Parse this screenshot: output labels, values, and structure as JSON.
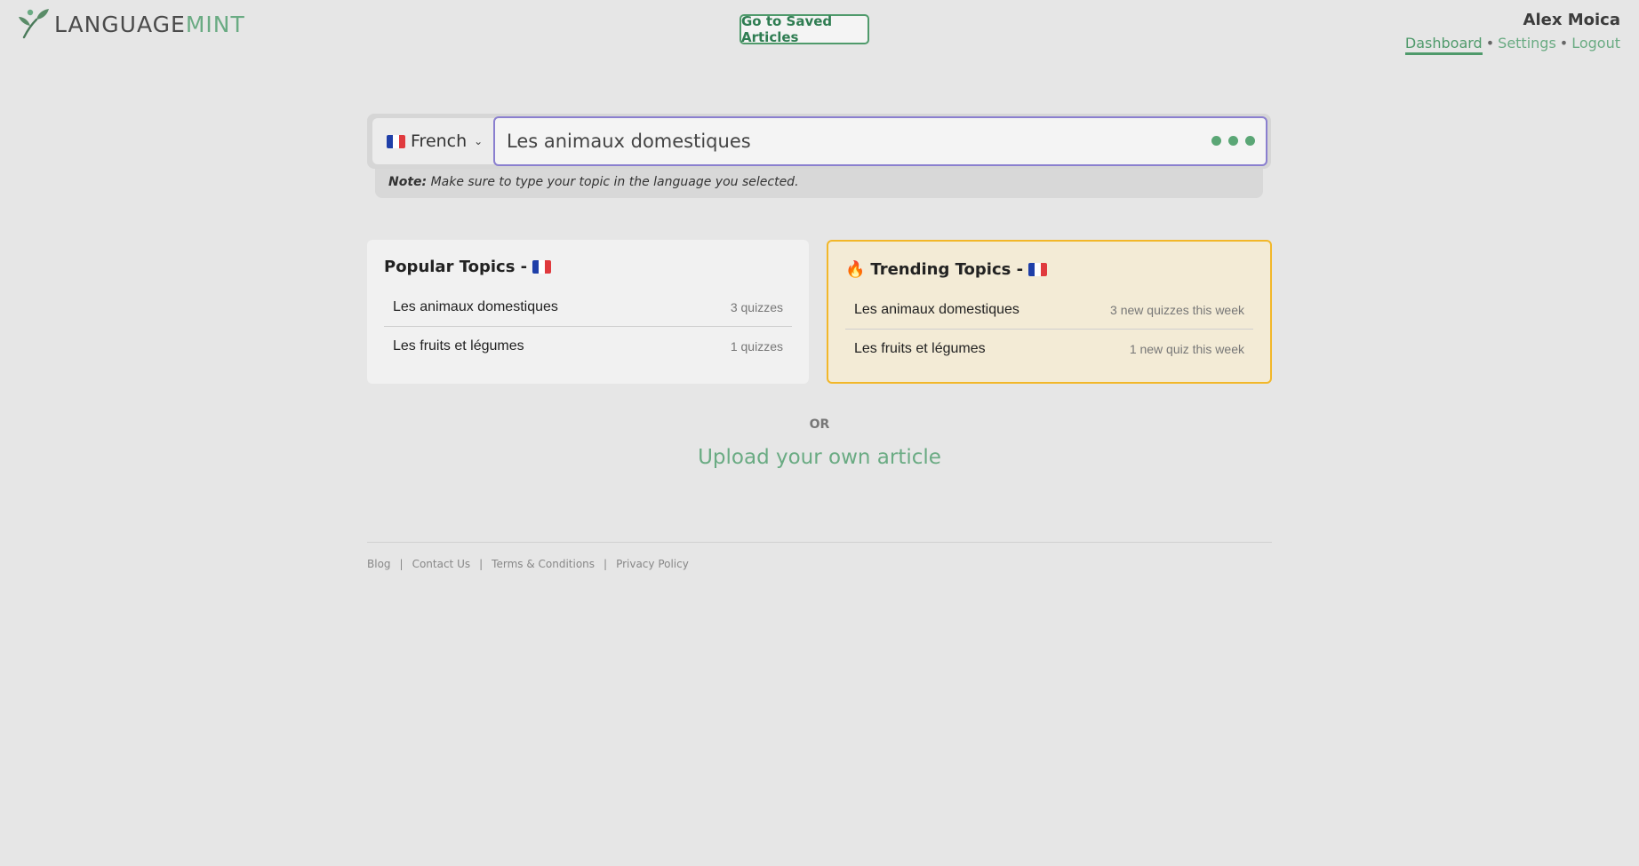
{
  "header": {
    "logo_lang": "LANGUAGE",
    "logo_mint": "MINT",
    "saved_button": "Go to Saved Articles",
    "user_name": "Alex Moica",
    "nav": {
      "dashboard": "Dashboard",
      "settings": "Settings",
      "logout": "Logout",
      "separator": "•"
    }
  },
  "search": {
    "language": "French",
    "value": "Les animaux domestiques",
    "note_label": "Note:",
    "note_text": " Make sure to type your topic in the language you selected."
  },
  "popular": {
    "title": "Popular Topics -",
    "items": [
      {
        "name": "Les animaux domestiques",
        "count": "3 quizzes"
      },
      {
        "name": "Les fruits et légumes",
        "count": "1 quizzes"
      }
    ]
  },
  "trending": {
    "title": "Trending Topics -",
    "items": [
      {
        "name": "Les animaux domestiques",
        "count": "3 new quizzes this week"
      },
      {
        "name": "Les fruits et légumes",
        "count": "1 new quiz this week"
      }
    ]
  },
  "or_text": "OR",
  "upload_text": "Upload your own article",
  "footer": {
    "blog": "Blog",
    "contact": "Contact Us",
    "terms": "Terms & Conditions",
    "privacy": "Privacy Policy",
    "separator": "|"
  },
  "colors": {
    "accent": "#4f9a6b",
    "mint": "#6aab83",
    "trending_border": "#f2b72a",
    "trending_bg": "#f3ebd6",
    "input_border": "#8a7fcf"
  }
}
